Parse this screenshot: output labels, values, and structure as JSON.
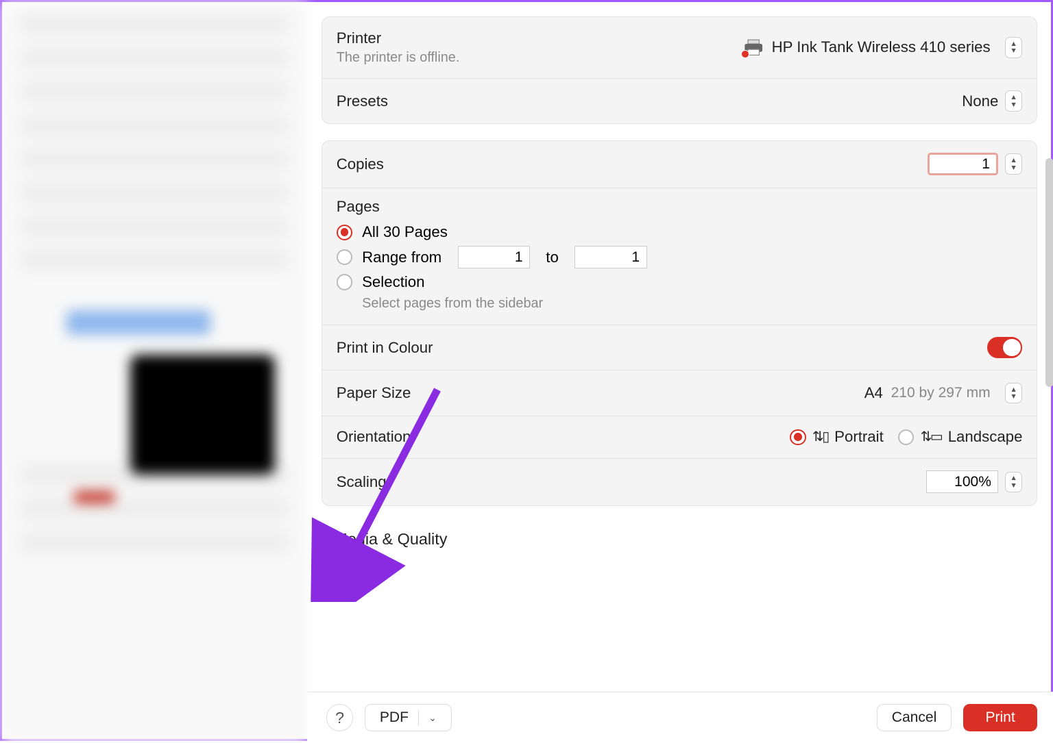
{
  "printer": {
    "label": "Printer",
    "name": "HP Ink Tank Wireless 410 series",
    "status": "The printer is offline."
  },
  "presets": {
    "label": "Presets",
    "value": "None"
  },
  "copies": {
    "label": "Copies",
    "value": "1"
  },
  "pages": {
    "label": "Pages",
    "all": "All 30 Pages",
    "range_label": "Range from",
    "range_to": "to",
    "range_from_val": "1",
    "range_to_val": "1",
    "selection": "Selection",
    "selection_hint": "Select pages from the sidebar"
  },
  "colour": {
    "label": "Print in Colour"
  },
  "paper": {
    "label": "Paper Size",
    "size": "A4",
    "dim": "210 by 297 mm"
  },
  "orientation": {
    "label": "Orientation",
    "portrait": "Portrait",
    "landscape": "Landscape"
  },
  "scaling": {
    "label": "Scaling",
    "value": "100%"
  },
  "media": {
    "label": "Media & Quality"
  },
  "footer": {
    "pdf": "PDF",
    "cancel": "Cancel",
    "print": "Print",
    "help": "?"
  }
}
